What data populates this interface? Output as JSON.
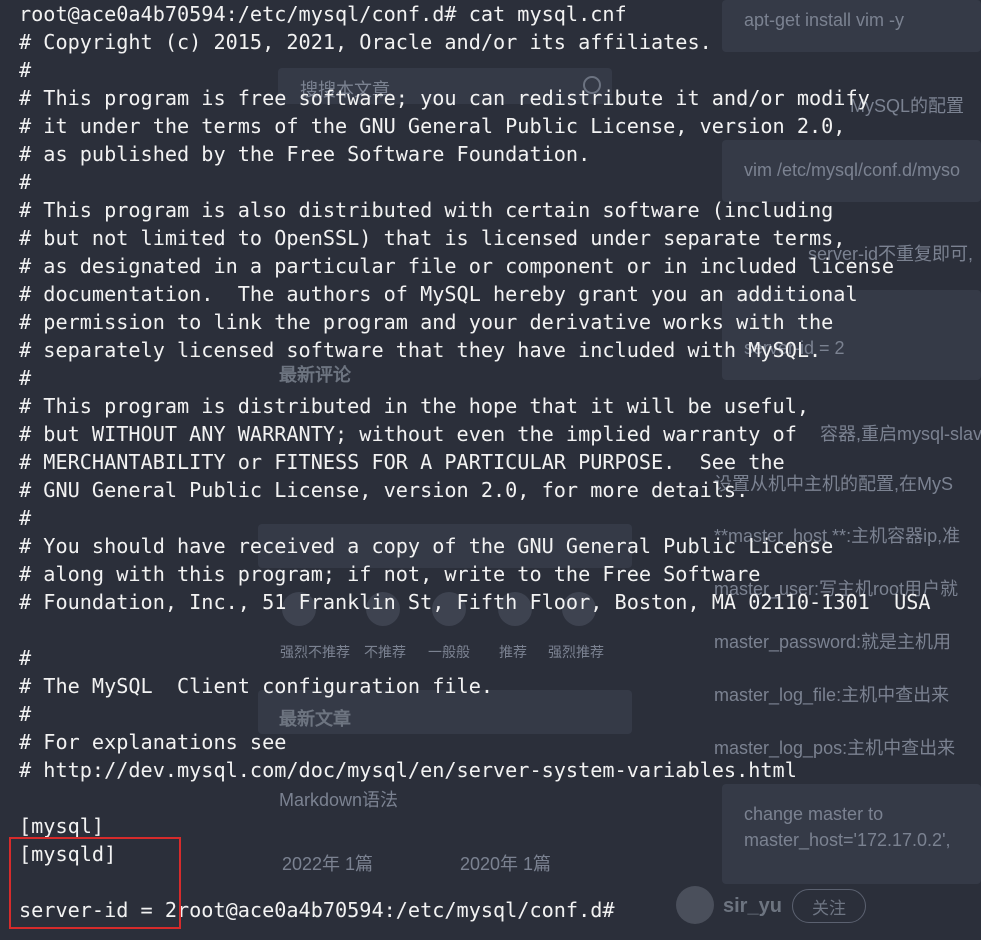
{
  "terminal": {
    "lines": [
      "root@ace0a4b70594:/etc/mysql/conf.d# cat mysql.cnf",
      "# Copyright (c) 2015, 2021, Oracle and/or its affiliates.",
      "#",
      "# This program is free software; you can redistribute it and/or modify",
      "# it under the terms of the GNU General Public License, version 2.0,",
      "# as published by the Free Software Foundation.",
      "#",
      "# This program is also distributed with certain software (including",
      "# but not limited to OpenSSL) that is licensed under separate terms,",
      "# as designated in a particular file or component or in included license",
      "# documentation.  The authors of MySQL hereby grant you an additional",
      "# permission to link the program and your derivative works with the",
      "# separately licensed software that they have included with MySQL.",
      "#",
      "# This program is distributed in the hope that it will be useful,",
      "# but WITHOUT ANY WARRANTY; without even the implied warranty of",
      "# MERCHANTABILITY or FITNESS FOR A PARTICULAR PURPOSE.  See the",
      "# GNU General Public License, version 2.0, for more details.",
      "#",
      "# You should have received a copy of the GNU General Public License",
      "# along with this program; if not, write to the Free Software",
      "# Foundation, Inc., 51 Franklin St, Fifth Floor, Boston, MA 02110-1301  USA",
      "",
      "#",
      "# The MySQL  Client configuration file.",
      "#",
      "# For explanations see",
      "# http://dev.mysql.com/doc/mysql/en/server-system-variables.html",
      "",
      "[mysql]",
      "[mysqld]",
      "",
      "server-id = 2root@ace0a4b70594:/etc/mysql/conf.d#"
    ]
  },
  "background": {
    "code_1": "apt-get install vim -y",
    "search_placeholder": "搜搜本文章",
    "frag_mysql_config": "MySQL的配置",
    "code_2": "vim /etc/mysql/conf.d/myso",
    "frag_server_id": "server-id不重复即可,",
    "code_3": "server-id = 2",
    "latest_comments": "最新评论",
    "frag_restart": "容器,重启mysql-slave",
    "frag_set_master": "设置从机中主机的配置,在MyS",
    "master_host_label": "**master_host **:主机容器ip,准",
    "master_user_label": "master_user:写主机root用户就",
    "master_password_label": "master_password:就是主机用",
    "master_log_file_label": "master_log_file:主机中查出来",
    "master_log_pos_label": "master_log_pos:主机中查出来",
    "rating_labels": [
      "强烈不推荐",
      "不推荐",
      "一般般",
      "推荐",
      "强烈推荐"
    ],
    "latest_articles": "最新文章",
    "markdown_link": "Markdown语法",
    "archive_2022": "2022年  1篇",
    "archive_2020": "2020年  1篇",
    "code_4_line1": "change master to",
    "code_4_line2": "master_host='172.17.0.2',",
    "author_name": "sir_yu",
    "follow_button": "关注"
  },
  "colors": {
    "terminal_text": "#f2f2f2",
    "highlight_border": "#d62b2b",
    "background": "#2b2f3a"
  }
}
